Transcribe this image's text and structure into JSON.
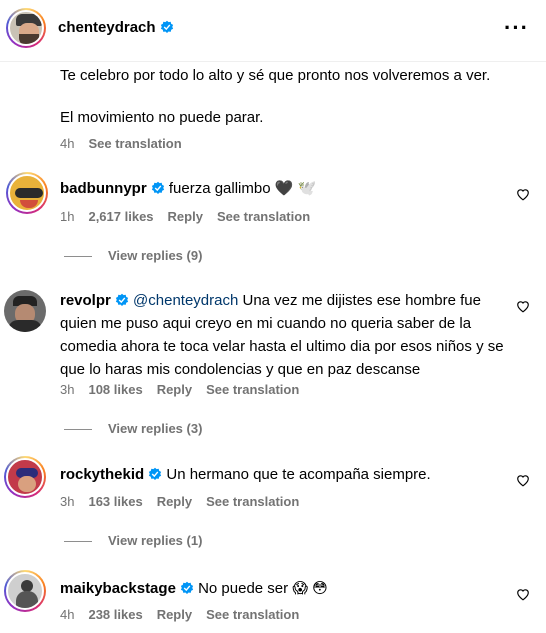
{
  "header": {
    "username": "chenteydrach"
  },
  "post": {
    "line1": "Te celebro por todo lo alto y sé que pronto nos volveremos a ver.",
    "line2": "El movimiento no puede parar.",
    "time": "4h",
    "see_translation": "See translation"
  },
  "comments": [
    {
      "user": "badbunnypr",
      "mention": "",
      "text": "fuerza gallimbo 🖤 🕊️",
      "time": "1h",
      "likes": "2,617 likes",
      "reply": "Reply",
      "see_translation": "See translation",
      "view_replies": "View replies (9)"
    },
    {
      "user": "revolpr",
      "mention": "@chenteydrach",
      "text": "Una vez me dijistes ese hombre fue quien me puso aqui creyo en mi cuando no queria saber de la comedia ahora te toca velar hasta el ultimo dia por esos niños y se que lo haras mis condolencias y que en paz descanse",
      "time": "3h",
      "likes": "108 likes",
      "reply": "Reply",
      "see_translation": "See translation",
      "view_replies": "View replies (3)"
    },
    {
      "user": "rockythekid",
      "mention": "",
      "text": "Un hermano que te acompaña siempre.",
      "time": "3h",
      "likes": "163 likes",
      "reply": "Reply",
      "see_translation": "See translation",
      "view_replies": "View replies (1)"
    },
    {
      "user": "maikybackstage",
      "mention": "",
      "text": "No puede ser 😱 😳",
      "time": "4h",
      "likes": "238 likes",
      "reply": "Reply",
      "see_translation": "See translation"
    }
  ],
  "colors": {
    "verified": "#0095f6",
    "muted": "#737373",
    "mention": "#00376b"
  }
}
